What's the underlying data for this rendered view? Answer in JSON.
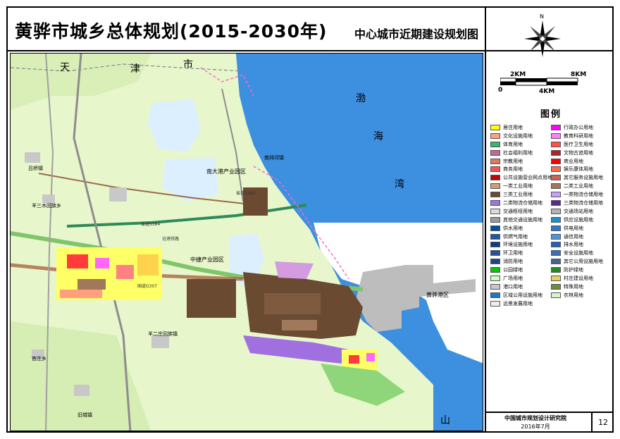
{
  "header": {
    "title": "黄骅市城乡总体规划(2015-2030年)",
    "subtitle": "中心城市近期建设规划图"
  },
  "compass": {
    "north": "N"
  },
  "scale": {
    "labels": [
      "0",
      "2KM",
      "4KM",
      "8KM"
    ]
  },
  "legend": {
    "title": "图例",
    "items": [
      {
        "label": "居住用地",
        "color": "#ffff00"
      },
      {
        "label": "行政办公用地",
        "color": "#ff00ff"
      },
      {
        "label": "文化设施用地",
        "color": "#ff9f7f"
      },
      {
        "label": "教育科研用地",
        "color": "#ff7fff"
      },
      {
        "label": "体育用地",
        "color": "#3cb371"
      },
      {
        "label": "医疗卫生用地",
        "color": "#ff4f4f"
      },
      {
        "label": "社会福利用地",
        "color": "#c86496"
      },
      {
        "label": "文物古迹用地",
        "color": "#b22222"
      },
      {
        "label": "宗教用地",
        "color": "#e07a5f"
      },
      {
        "label": "商业用地",
        "color": "#ff0000"
      },
      {
        "label": "商务用地",
        "color": "#ff5050"
      },
      {
        "label": "娱乐康体用地",
        "color": "#ff6a4a"
      },
      {
        "label": "公共设施营业网点用地",
        "color": "#c80000"
      },
      {
        "label": "其它服务设施用地",
        "color": "#c86450"
      },
      {
        "label": "一类工业用地",
        "color": "#c8a078"
      },
      {
        "label": "二类工业用地",
        "color": "#a0785a"
      },
      {
        "label": "三类工业用地",
        "color": "#6e4a32"
      },
      {
        "label": "一类物流仓储用地",
        "color": "#c8a0ff"
      },
      {
        "label": "二类物流仓储用地",
        "color": "#a070e0"
      },
      {
        "label": "三类物流仓储用地",
        "color": "#5a2a8a"
      },
      {
        "label": "交通枢纽用地",
        "color": "#dcdcdc"
      },
      {
        "label": "交通场站用地",
        "color": "#b4b4b4"
      },
      {
        "label": "其他交通设施用地",
        "color": "#9a9a9a"
      },
      {
        "label": "供应设施用地",
        "color": "#1e90c8"
      },
      {
        "label": "供水用地",
        "color": "#0050a0"
      },
      {
        "label": "供电用地",
        "color": "#3278c8"
      },
      {
        "label": "供燃气用地",
        "color": "#1e5aa0"
      },
      {
        "label": "通信用地",
        "color": "#5096dc"
      },
      {
        "label": "环境设施用地",
        "color": "#0a3c8c"
      },
      {
        "label": "排水用地",
        "color": "#1e64b4"
      },
      {
        "label": "环卫用地",
        "color": "#2850a0"
      },
      {
        "label": "安全设施用地",
        "color": "#3c6eb4"
      },
      {
        "label": "消防用地",
        "color": "#1e4678"
      },
      {
        "label": "其它公用设施用地",
        "color": "#46648c"
      },
      {
        "label": "公园绿地",
        "color": "#00c800"
      },
      {
        "label": "防护绿地",
        "color": "#1e8c1e"
      },
      {
        "label": "广场用地",
        "color": "#c8ffc8"
      },
      {
        "label": "村庄建设用地",
        "color": "#e6d264"
      },
      {
        "label": "港口用地",
        "color": "#c8c8c8"
      },
      {
        "label": "特殊用地",
        "color": "#6e8c3c"
      },
      {
        "label": "区域公用设施用地",
        "color": "#1e78c8"
      },
      {
        "label": "农林用地",
        "color": "#dcf5c8"
      },
      {
        "label": "远景发展用地",
        "color": "#eeeeee"
      }
    ]
  },
  "map_labels": {
    "tianjin_tian": "天",
    "tianjin_jin": "津",
    "tianjin_shi": "市",
    "bohai_bo": "渤",
    "bohai_hai": "海",
    "bohai_wan": "湾",
    "shandong_shan": "山",
    "nandagang": "南大港产业园区",
    "zhongjie": "中捷产业园区",
    "port": "黄骅港区",
    "lvshui": "吕桥镇",
    "yangsan": "羊三木回族乡",
    "jiuzhuang": "旧城镇",
    "guanzhuang": "官庄乡",
    "fengjiazhuang": "羊二庄回族镇",
    "nanpaihe": "南排河镇",
    "road_s384": "省道S384",
    "road_g307": "国道G307",
    "railway": "沧港铁路",
    "road_s364": "省道S364"
  },
  "footer": {
    "institute": "中国城市规划设计研究院",
    "date": "2016年7月",
    "page": "12"
  },
  "colors": {
    "sea": "#3d8fe0",
    "land": "#e6f5c8",
    "industry": "#6b4a32",
    "port": "#bdbdbd",
    "green_belt": "#8fd67a"
  }
}
